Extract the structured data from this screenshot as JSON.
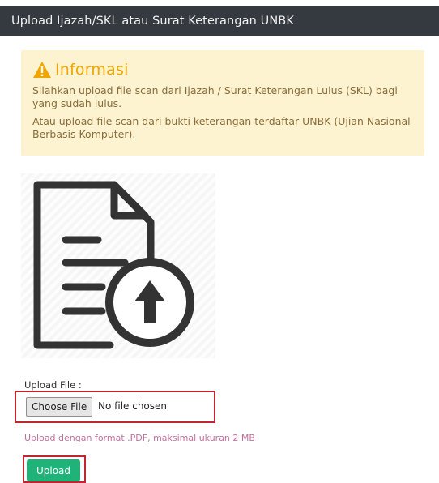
{
  "header": {
    "title": "Upload Ijazah/SKL atau Surat Keterangan UNBK"
  },
  "alert": {
    "title": "Informasi",
    "line1": "Silahkan upload file scan dari Ijazah / Surat Keterangan Lulus (SKL) bagi yang sudah lulus.",
    "line2": "Atau upload file scan dari bukti keterangan terdaftar UNBK (Ujian Nasional Berbasis Komputer).",
    "icon": "warning-triangle-icon",
    "accent": "#f0a500"
  },
  "preview": {
    "icon": "document-upload-icon"
  },
  "form": {
    "label": "Upload File :",
    "choose_label": "Choose File",
    "file_status": "No file chosen",
    "hint": "Upload dengan format .PDF, maksimal ukuran 2 MB",
    "submit_label": "Upload",
    "submit_color": "#1fb37a",
    "highlight_color": "#c0262d"
  }
}
